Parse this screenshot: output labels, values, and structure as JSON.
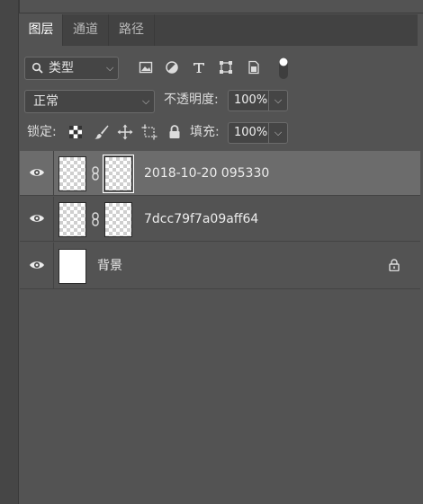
{
  "tabs": [
    {
      "label": "图层",
      "active": true
    },
    {
      "label": "通道",
      "active": false
    },
    {
      "label": "路径",
      "active": false
    }
  ],
  "filter": {
    "kind_label": "类型",
    "icons": [
      "image-filter-icon",
      "adjustment-filter-icon",
      "type-filter-icon",
      "shape-filter-icon",
      "smart-object-filter-icon",
      "filter-toggle-icon"
    ]
  },
  "blend": {
    "mode": "正常",
    "opacity_label": "不透明度:",
    "opacity_value": "100%"
  },
  "lock": {
    "label": "锁定:",
    "icons": [
      "lock-transparent-pixels-icon",
      "lock-image-pixels-icon",
      "lock-position-icon",
      "lock-artboard-icon",
      "lock-all-icon"
    ],
    "fill_label": "填充:",
    "fill_value": "100%"
  },
  "layers": [
    {
      "name": "2018-10-20 095330",
      "selected": true,
      "has_mask": true,
      "locked": false
    },
    {
      "name": "7dcc79f7a09aff64",
      "selected": false,
      "has_mask": true,
      "locked": false
    },
    {
      "name": "背景",
      "selected": false,
      "has_mask": false,
      "locked": true
    }
  ],
  "colors": {
    "panel_bg": "#535353",
    "selected_row": "#6c6c6c",
    "tab_bar": "#424242"
  }
}
